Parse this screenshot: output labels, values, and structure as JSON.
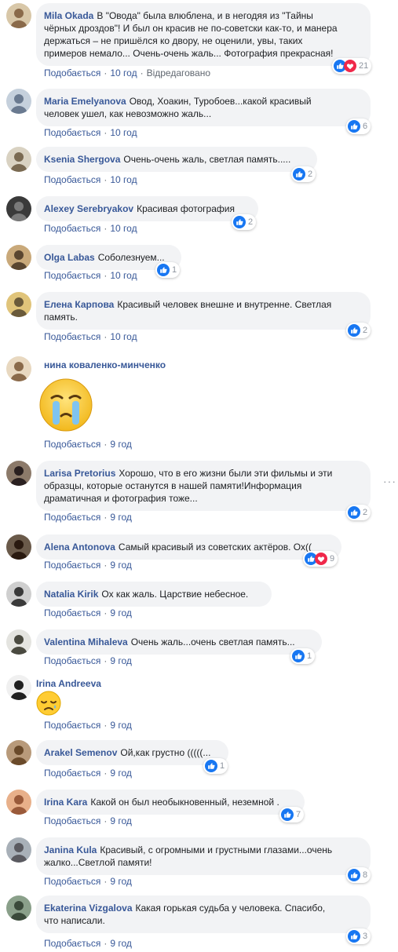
{
  "ui": {
    "like_label": "Подобається",
    "edited_label": "Відредаговано",
    "more_label": "···"
  },
  "colors": {
    "name": "#385898",
    "bubble": "#f2f3f5",
    "meta": "#606770",
    "like_blue": "#1877f2",
    "love_red": "#f0284a"
  },
  "comments": [
    {
      "name": "Mila Okada",
      "text_lines": [
        "В \"Овода\" была влюблена, и в негодяя из \"Тайны",
        "чёрных дроздов\"! И был он красив не по-советски как-то, и манера",
        "держаться – не пришёлся ко двору, не оценили, увы, таких",
        "примеров немало... Очень-очень жаль... Фотография прекрасная!"
      ],
      "time": "10 год",
      "edited": "Відредаговано",
      "reactions": [
        "like",
        "love"
      ],
      "count": "21",
      "avatar": "avatar-mila-okada"
    },
    {
      "name": "Maria Emelyanova",
      "text_lines": [
        "Овод, Хоакин, Туробоев...какой красивый",
        "человек ушел, как невозможно жаль..."
      ],
      "time": "10 год",
      "reactions": [
        "like"
      ],
      "count": "6",
      "avatar": "avatar-maria-emelyanova"
    },
    {
      "name": "Ksenia Shergova",
      "text_lines": [
        "Очень-очень жаль, светлая память....."
      ],
      "time": "10 год",
      "reactions": [
        "like"
      ],
      "count": "2",
      "avatar": "avatar-ksenia-shergova"
    },
    {
      "name": "Alexey Serebryakov",
      "text_lines": [
        "Красивая фотография"
      ],
      "time": "10 год",
      "reactions": [
        "like"
      ],
      "count": "2",
      "avatar": "avatar-alexey-serebryakov"
    },
    {
      "name": "Olga Labas",
      "text_lines": [
        "Соболезнуем..."
      ],
      "time": "10 год",
      "reactions": [
        "like"
      ],
      "count": "1",
      "avatar": "avatar-olga-labas"
    },
    {
      "name": "Елена Карпова",
      "text_lines": [
        "Красивый человек внешне и внутренне. Светлая",
        "память."
      ],
      "time": "10 год",
      "reactions": [
        "like"
      ],
      "count": "2",
      "avatar": "avatar-elena-karpova"
    },
    {
      "name": "нина коваленко-минченко",
      "text_lines": [],
      "time": "9 год",
      "sticker": "crying-face-sticker",
      "avatar": "avatar-nina-kovalenko"
    },
    {
      "name": "Larisa Pretorius",
      "text_lines": [
        "Хорошо, что в его жизни были эти фильмы и эти",
        "образцы, которые останутся в нашей памяти!Информация",
        "драматичная и фотография тоже..."
      ],
      "time": "9 год",
      "reactions": [
        "like"
      ],
      "count": "2",
      "avatar": "avatar-larisa-pretorius"
    },
    {
      "name": "Alena Antonova",
      "text_lines": [
        "Самый красивый из советских актёров. Ох(("
      ],
      "time": "9 год",
      "reactions": [
        "like",
        "love"
      ],
      "count": "9",
      "avatar": "avatar-alena-antonova"
    },
    {
      "name": "Natalia Kirik",
      "text_lines": [
        "Ох как жаль. Царствие небесное."
      ],
      "time": "9 год",
      "avatar": "avatar-natalia-kirik"
    },
    {
      "name": "Valentina Mihaleva",
      "text_lines": [
        "Очень жаль...очень светлая память..."
      ],
      "time": "9 год",
      "reactions": [
        "like"
      ],
      "count": "1",
      "avatar": "avatar-valentina-mihaleva"
    },
    {
      "name": "Irina Andreeva",
      "text_lines": [],
      "time": "9 год",
      "sticker": "sad-sleepy-emoji",
      "avatar": "avatar-irina-andreeva"
    },
    {
      "name": "Arakel Semenov",
      "text_lines": [
        "Ой,как грустно (((((..."
      ],
      "time": "9 год",
      "reactions": [
        "like"
      ],
      "count": "1",
      "avatar": "avatar-arakel-semenov"
    },
    {
      "name": "Irina Kara",
      "text_lines": [
        "Какой он был необыкновенный, неземной ."
      ],
      "time": "9 год",
      "reactions": [
        "like"
      ],
      "count": "7",
      "avatar": "avatar-irina-kara"
    },
    {
      "name": "Janina Kula",
      "text_lines": [
        "Красивый, с огромными и грустными глазами...очень",
        "жалко...Светлой памяти!"
      ],
      "time": "9 год",
      "reactions": [
        "like"
      ],
      "count": "8",
      "avatar": "avatar-janina-kula"
    },
    {
      "name": "Ekaterina Vizgalova",
      "text_lines": [
        "Какая горькая судьба у человека. Спасибо,",
        "что написали."
      ],
      "time": "9 год",
      "reactions": [
        "like"
      ],
      "count": "3",
      "avatar": "avatar-ekaterina-vizgalova"
    }
  ]
}
